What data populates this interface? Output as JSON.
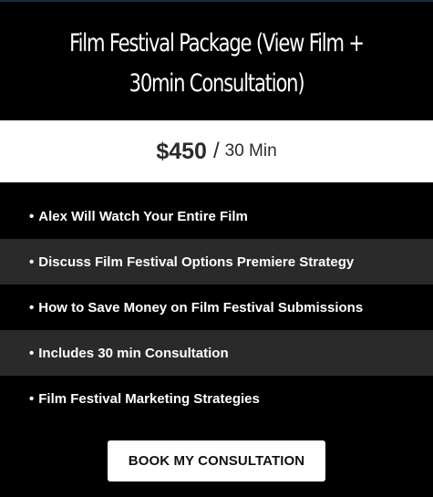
{
  "package": {
    "title": "Film Festival Package (View Film + 30min Consultation)",
    "price": "$450",
    "separator": "/",
    "term": "30 Min"
  },
  "features": [
    {
      "bullet": "•",
      "text": "Alex Will Watch Your Entire Film"
    },
    {
      "bullet": "•",
      "text": "Discuss Film Festival Options Premiere Strategy"
    },
    {
      "bullet": "•",
      "text": "How to Save Money on Film Festival Submissions"
    },
    {
      "bullet": "•",
      "text": "Includes 30 min Consultation"
    },
    {
      "bullet": "•",
      "text": "Film Festival Marketing Strategies"
    }
  ],
  "cta": {
    "label": "BOOK MY CONSULTATION"
  },
  "colors": {
    "background": "#000000",
    "price_bar": "#ffffff",
    "alt_row": "#2a2a2a",
    "text_light": "#ffffff",
    "text_dark": "#2b2b2b"
  }
}
